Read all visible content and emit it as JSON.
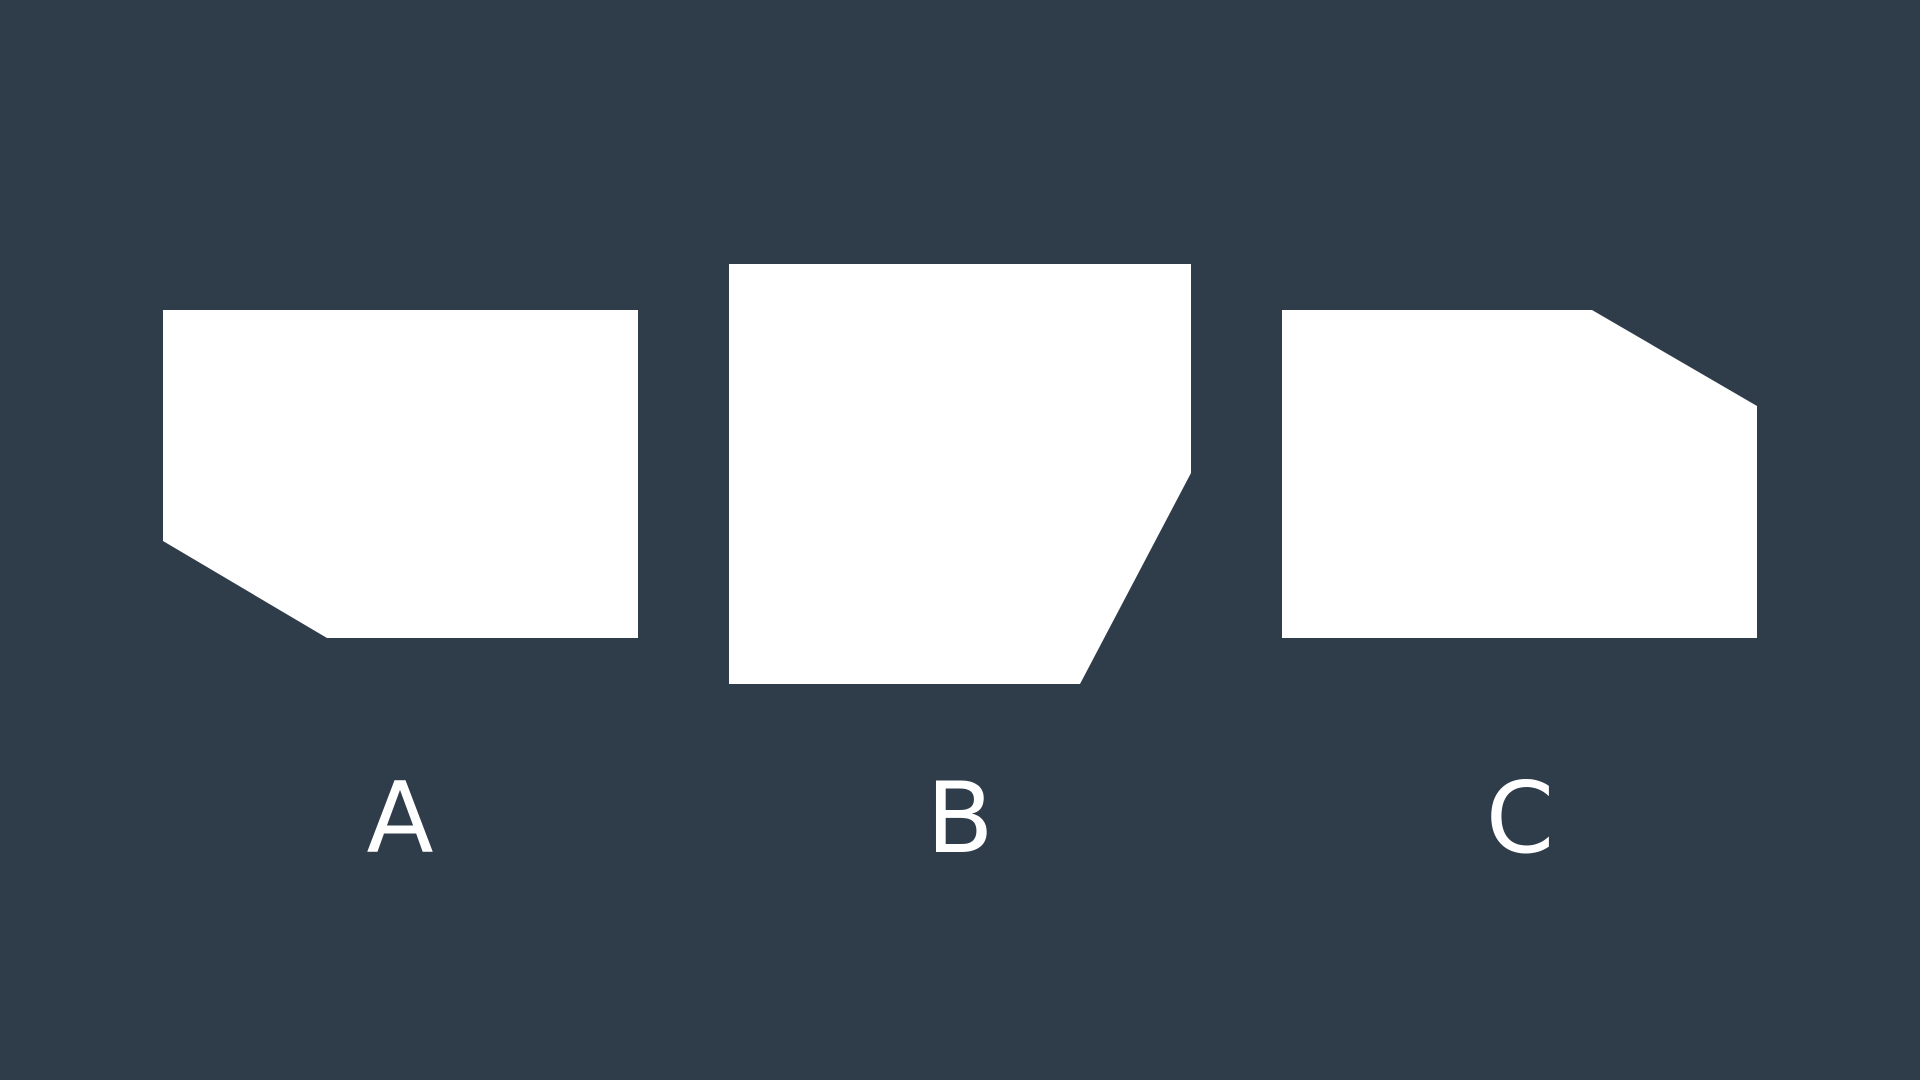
{
  "colors": {
    "background": "#2F3C4A",
    "shape_fill": "#FFFFFF",
    "label_color": "#FFFFFF"
  },
  "options": [
    {
      "label": "A",
      "shape": "rectangle-with-bottom-left-corner-cut"
    },
    {
      "label": "B",
      "shape": "rectangle-with-bottom-right-corner-cut"
    },
    {
      "label": "C",
      "shape": "rectangle-with-top-right-corner-cut"
    }
  ]
}
